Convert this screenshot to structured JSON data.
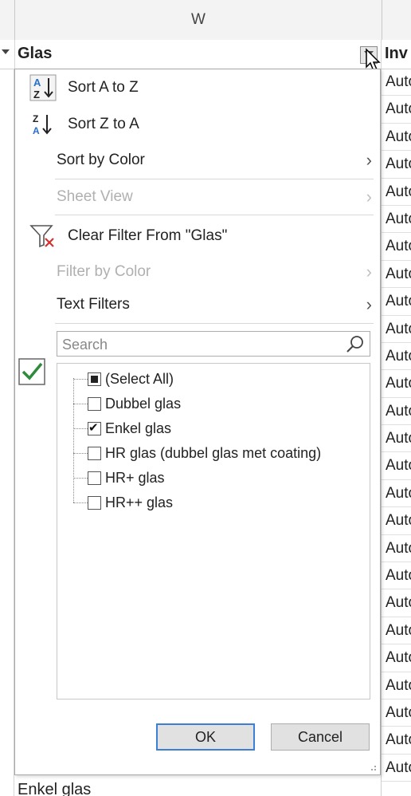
{
  "column_header": {
    "letter": "W"
  },
  "table_header": {
    "glas_label": "Glas",
    "inv_label": "Inv"
  },
  "right_column_cells": [
    "Auto",
    "Auto",
    "Auto",
    "Auto",
    "Auto",
    "Auto",
    "Auto",
    "Auto",
    "Auto",
    "Auto",
    "Auto",
    "Auto",
    "Auto",
    "Auto",
    "Auto",
    "Auto",
    "Auto",
    "Auto",
    "Auto",
    "Auto",
    "Auto",
    "Auto",
    "Auto",
    "Auto",
    "Auto",
    "Auto"
  ],
  "bottom_cell": "Enkel glas",
  "menu": {
    "sort_az": "Sort A to Z",
    "sort_za": "Sort Z to A",
    "sort_by_color": "Sort by Color",
    "sheet_view": "Sheet View",
    "clear_filter": "Clear Filter From \"Glas\"",
    "filter_by_color": "Filter by Color",
    "text_filters": "Text Filters"
  },
  "search": {
    "placeholder": "Search"
  },
  "filter_list": [
    {
      "label": "(Select All)",
      "state": "partial"
    },
    {
      "label": "Dubbel glas",
      "state": "unchecked"
    },
    {
      "label": "Enkel glas",
      "state": "checked"
    },
    {
      "label": "HR glas (dubbel glas met coating)",
      "state": "unchecked"
    },
    {
      "label": "HR+ glas",
      "state": "unchecked"
    },
    {
      "label": "HR++ glas",
      "state": "unchecked"
    }
  ],
  "buttons": {
    "ok": "OK",
    "cancel": "Cancel"
  },
  "colors": {
    "accent": "#3c7fd6",
    "green_check": "#2e8b3a",
    "clear_x": "#d32f2f",
    "sort_blue": "#2a6fc9"
  },
  "icons": [
    "sort-az-icon",
    "sort-za-icon",
    "clear-filter-icon",
    "search-icon",
    "green-check-icon",
    "filter-dropdown-icon",
    "mouse-cursor-icon",
    "chevron-right-icon"
  ]
}
